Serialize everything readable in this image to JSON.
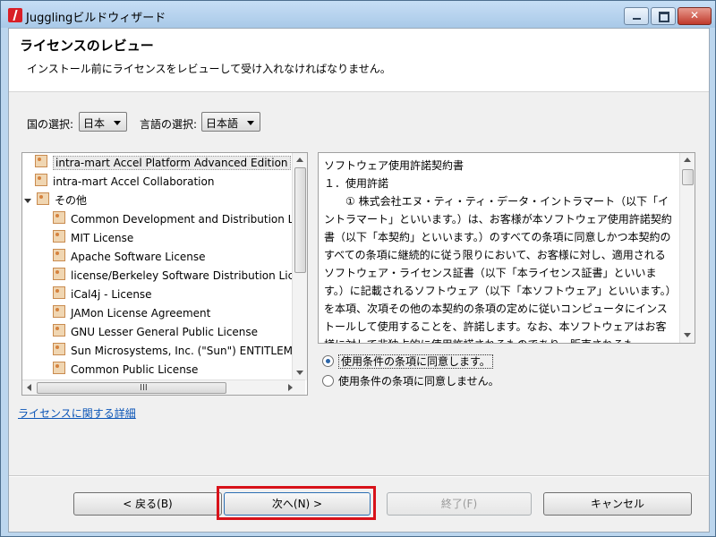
{
  "window": {
    "title": "Jugglingビルドウィザード"
  },
  "header": {
    "title": "ライセンスのレビュー",
    "description": "インストール前にライセンスをレビューして受け入れなければなりません。"
  },
  "filters": {
    "country_label": "国の選択:",
    "country_value": "日本",
    "language_label": "言語の選択:",
    "language_value": "日本語"
  },
  "tree": {
    "items": [
      {
        "label": "intra-mart Accel Platform Advanced Edition"
      },
      {
        "label": "intra-mart Accel Collaboration"
      },
      {
        "label": "その他"
      },
      {
        "label": "Common Development and Distribution License"
      },
      {
        "label": "MIT License"
      },
      {
        "label": "Apache Software License"
      },
      {
        "label": "license/Berkeley Software Distribution License"
      },
      {
        "label": "iCal4j - License"
      },
      {
        "label": "JAMon License Agreement"
      },
      {
        "label": "GNU Lesser General Public License"
      },
      {
        "label": "Sun Microsystems, Inc. (\"Sun\") ENTITLEMENT"
      },
      {
        "label": "Common Public License"
      }
    ]
  },
  "license": {
    "text": "ソフトウェア使用許諾契約書\n１．使用許諾\n　　① 株式会社エヌ・ティ・ティ・データ・イントラマート（以下「イントラマート」といいます。）は、お客様が本ソフトウェア使用許諾契約書（以下「本契約」といいます。）のすべての条項に同意しかつ本契約のすべての条項に継続的に従う限りにおいて、お客様に対し、適用されるソフトウェア・ライセンス証書（以下「本ライセンス証書」といいます。）に記載されるソフトウェア（以下「本ソフトウェア」といいます。）を本項、次項その他の本契約の条項の定めに従いコンピュータにインストールして使用することを、許諾します。なお、本ソフトウェアはお客様に対して非独占的に使用許諾されるものであり、販売されるも"
  },
  "agreement": {
    "accept_label": "使用条件の条項に同意します。",
    "decline_label": "使用条件の条項に同意しません。",
    "selected": "accept"
  },
  "details_link": "ライセンスに関する詳細",
  "buttons": {
    "back": "< 戻る(B)",
    "next": "次へ(N) >",
    "finish": "終了(F)",
    "cancel": "キャンセル"
  }
}
